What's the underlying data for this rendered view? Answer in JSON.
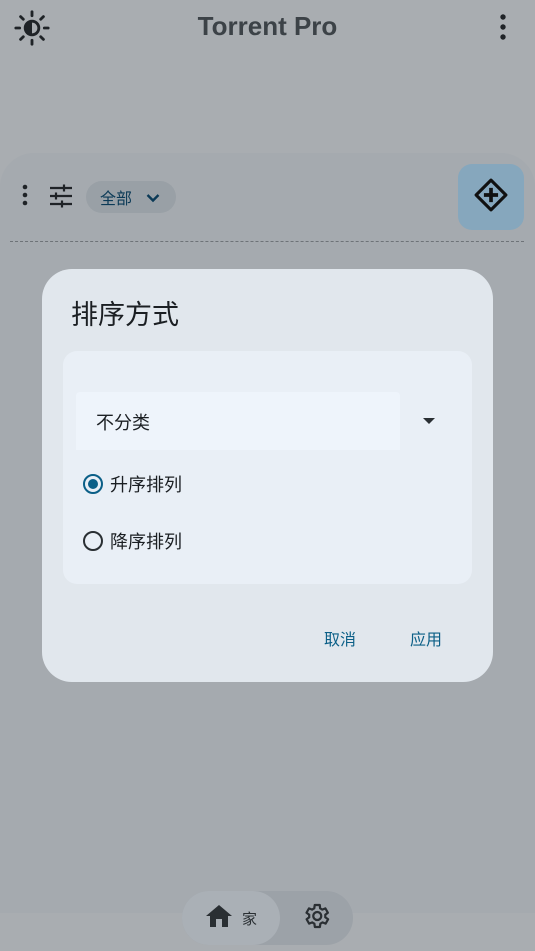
{
  "app": {
    "title": "Torrent Pro"
  },
  "toolbar": {
    "filter_chip_label": "全部"
  },
  "dialog": {
    "title": "排序方式",
    "sort_field": {
      "value": "不分类"
    },
    "options": [
      {
        "label": "升序排列",
        "checked": true
      },
      {
        "label": "降序排列",
        "checked": false
      }
    ],
    "cancel_label": "取消",
    "apply_label": "应用"
  },
  "bottom_nav": {
    "home_label": "家"
  },
  "colors": {
    "accent": "#0b5f87",
    "scrim": "#a9adb1",
    "dialog_bg": "#e1e7ed"
  },
  "icons": [
    "brightness-icon",
    "more-vert-icon",
    "tune-icon",
    "chevron-down-icon",
    "directions-icon",
    "dropdown-arrow-icon",
    "home-icon",
    "settings-icon"
  ]
}
